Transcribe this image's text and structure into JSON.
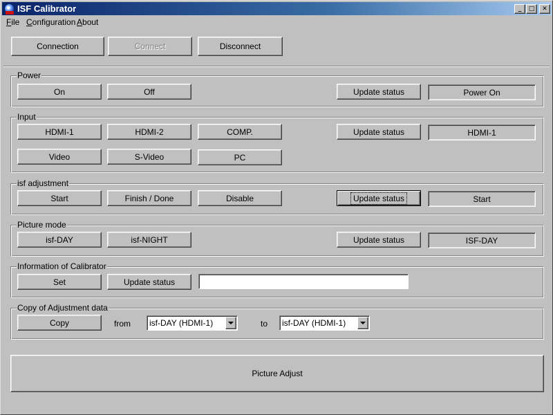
{
  "window": {
    "title": "ISF Calibrator"
  },
  "menu": [
    {
      "accel": "F",
      "rest": "ile"
    },
    {
      "accel": "C",
      "rest": "onfiguration"
    },
    {
      "accel": "A",
      "rest": "bout"
    }
  ],
  "connection": {
    "connection_label": "Connection",
    "connect_label": "Connect",
    "disconnect_label": "Disconnect"
  },
  "power": {
    "title": "Power",
    "on_label": "On",
    "off_label": "Off",
    "update_label": "Update status",
    "status": "Power On"
  },
  "input": {
    "title": "Input",
    "hdmi1_label": "HDMI-1",
    "hdmi2_label": "HDMI-2",
    "comp_label": "COMP.",
    "video_label": "Video",
    "svideo_label": "S-Video",
    "pc_label": "PC",
    "update_label": "Update status",
    "status": "HDMI-1"
  },
  "isf": {
    "title": "isf adjustment",
    "start_label": "Start",
    "finish_label": "Finish / Done",
    "disable_label": "Disable",
    "update_label": "Update status",
    "status": "Start"
  },
  "picture_mode": {
    "title": "Picture mode",
    "day_label": "isf-DAY",
    "night_label": "isf-NIGHT",
    "update_label": "Update status",
    "status": "ISF-DAY"
  },
  "calibrator_info": {
    "title": "Information of Calibrator",
    "set_label": "Set",
    "update_label": "Update status",
    "value": ""
  },
  "copy": {
    "title": "Copy of Adjustment data",
    "copy_label": "Copy",
    "from_label": "from",
    "from_value": "isf-DAY (HDMI-1)",
    "to_label": "to",
    "to_value": "isf-DAY (HDMI-1)"
  },
  "picture_adjust": {
    "label": "Picture Adjust"
  }
}
